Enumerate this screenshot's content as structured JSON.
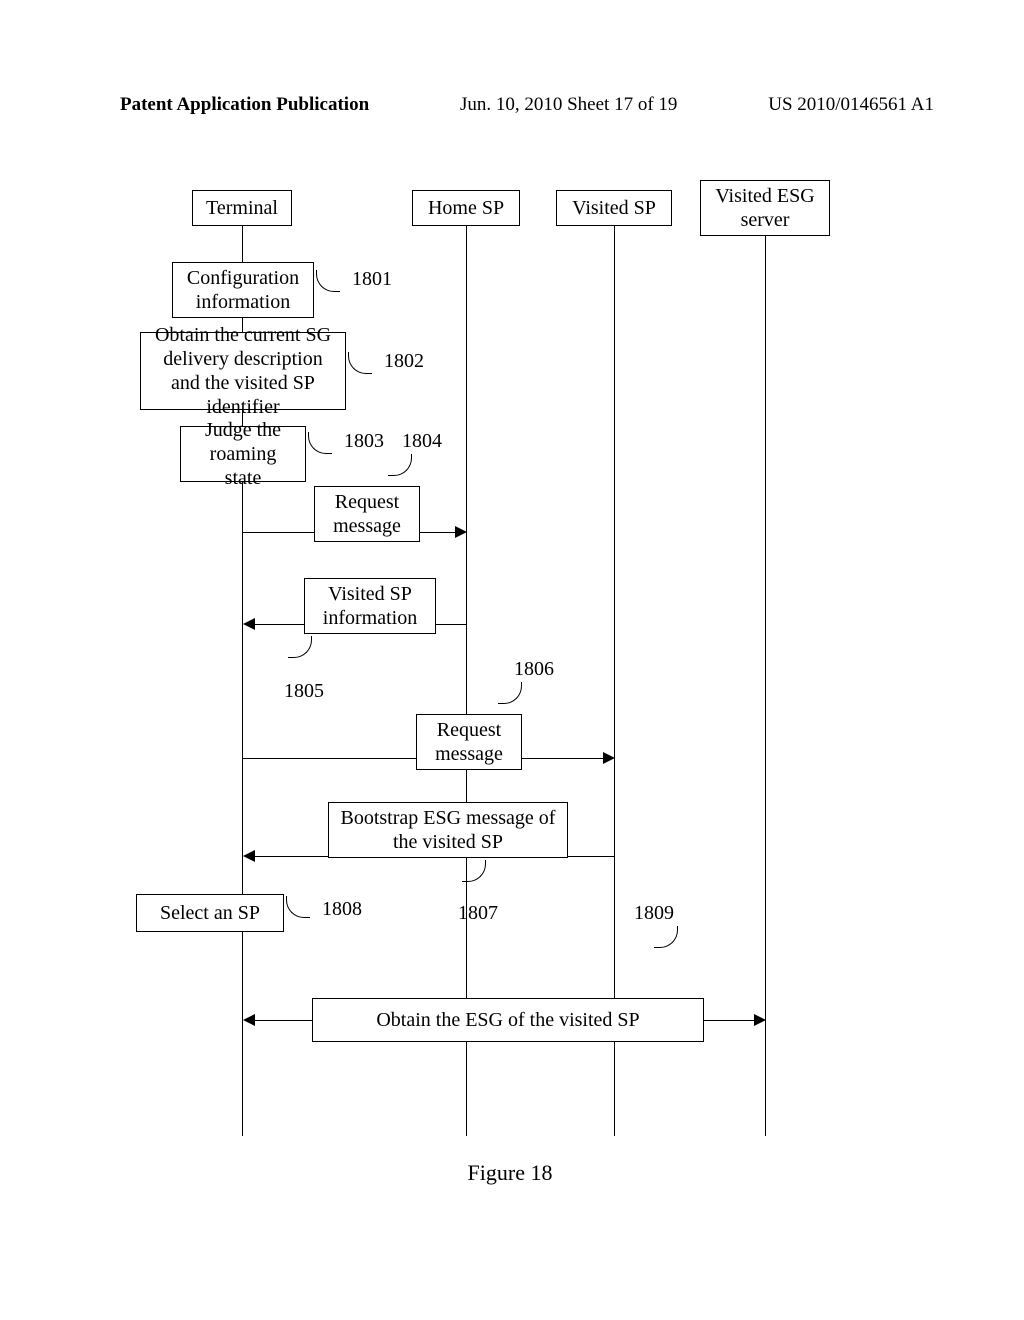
{
  "header": {
    "left": "Patent Application Publication",
    "center": "Jun. 10, 2010  Sheet 17 of 19",
    "right": "US 2010/0146561 A1"
  },
  "actors": {
    "terminal": "Terminal",
    "home_sp": "Home SP",
    "visited_sp": "Visited SP",
    "visited_esg_server": "Visited ESG server"
  },
  "boxes": {
    "config": "Configuration information",
    "obtain_sg": "Obtain the current SG delivery description and the visited SP identifier",
    "judge": "Judge the roaming state",
    "request1": "Request message",
    "visited_sp_info": "Visited SP information",
    "request2": "Request message",
    "bootstrap": "Bootstrap ESG message of the visited SP",
    "select_sp": "Select an SP",
    "obtain_esg": "Obtain the ESG of the visited SP"
  },
  "refs": {
    "r1801": "1801",
    "r1802": "1802",
    "r1803": "1803",
    "r1804": "1804",
    "r1805": "1805",
    "r1806": "1806",
    "r1807": "1807",
    "r1808": "1808",
    "r1809": "1809"
  },
  "caption": "Figure 18"
}
